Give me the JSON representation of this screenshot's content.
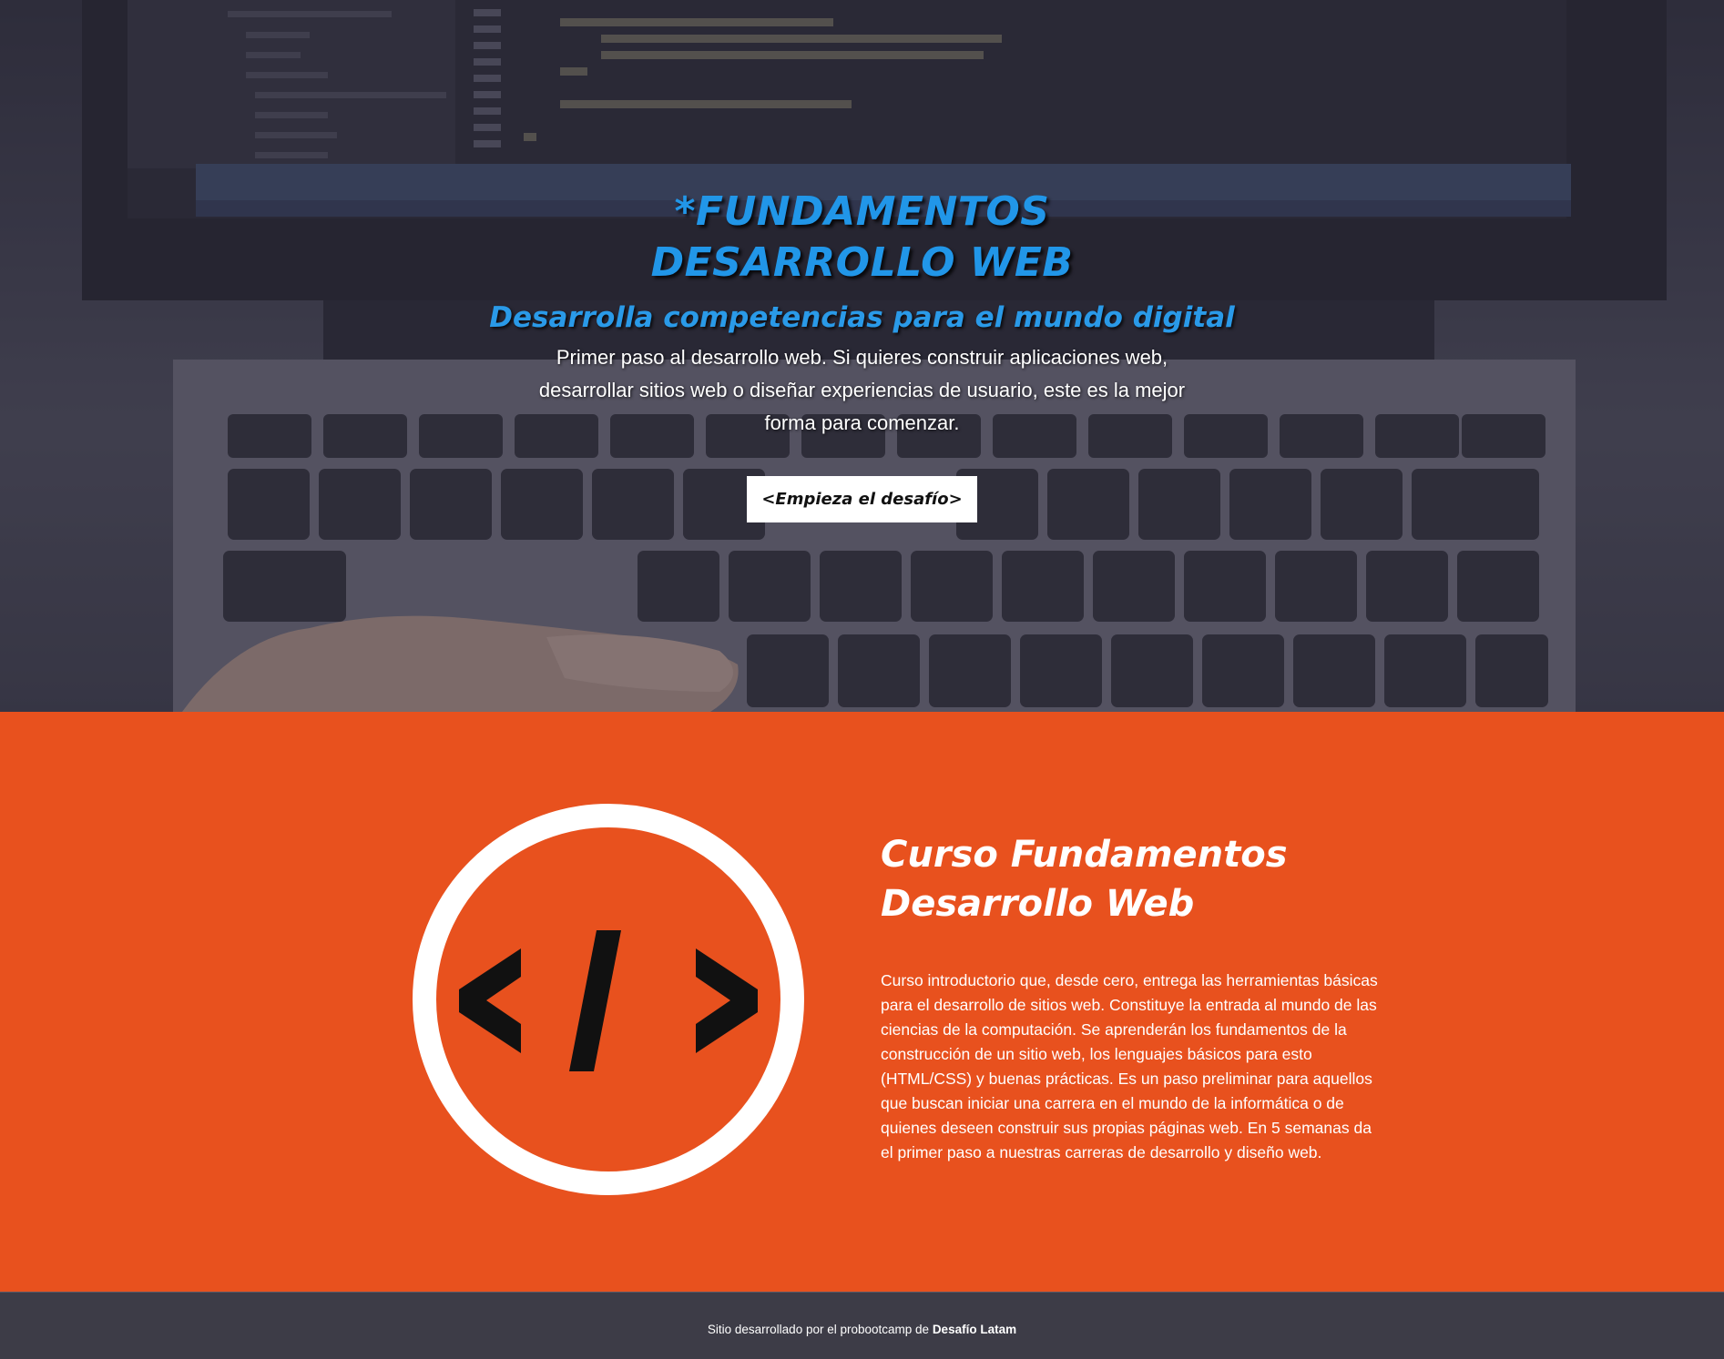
{
  "hero": {
    "title": "*FUNDAMENTOS DESARROLLO WEB",
    "subtitle": "Desarrolla competencias para el mundo digital",
    "description": "Primer paso al desarrollo web. Si quieres construir aplicaciones web, desarrollar sitios web o diseñar experiencias de usuario, este es la mejor forma para comenzar.",
    "cta_label": "<Empieza el desafío>"
  },
  "course": {
    "title": "Curso Fundamentos Desarrollo Web",
    "description": "Curso introductorio que, desde cero, entrega las herramientas básicas para el desarrollo de sitios web. Constituye la entrada al mundo de las ciencias de la computación. Se aprenderán los fundamentos de la construcción de un sitio web, los lenguajes básicos para esto (HTML/CSS) y buenas prácticas. Es un paso preliminar para aquellos que buscan iniciar una carrera en el mundo de la informática o de quienes deseen construir sus propias páginas web. En 5 semanas da el primer paso a nuestras carreras de desarrollo y diseño web.",
    "logo_icon": "code-tag-icon"
  },
  "footer": {
    "prefix": "Sitio desarrollado por el probootcamp de",
    "brand": "Desafío Latam"
  },
  "colors": {
    "accent_orange": "#e8511e",
    "title_blue": "#2196e8",
    "footer_bg": "#3d3c47"
  }
}
